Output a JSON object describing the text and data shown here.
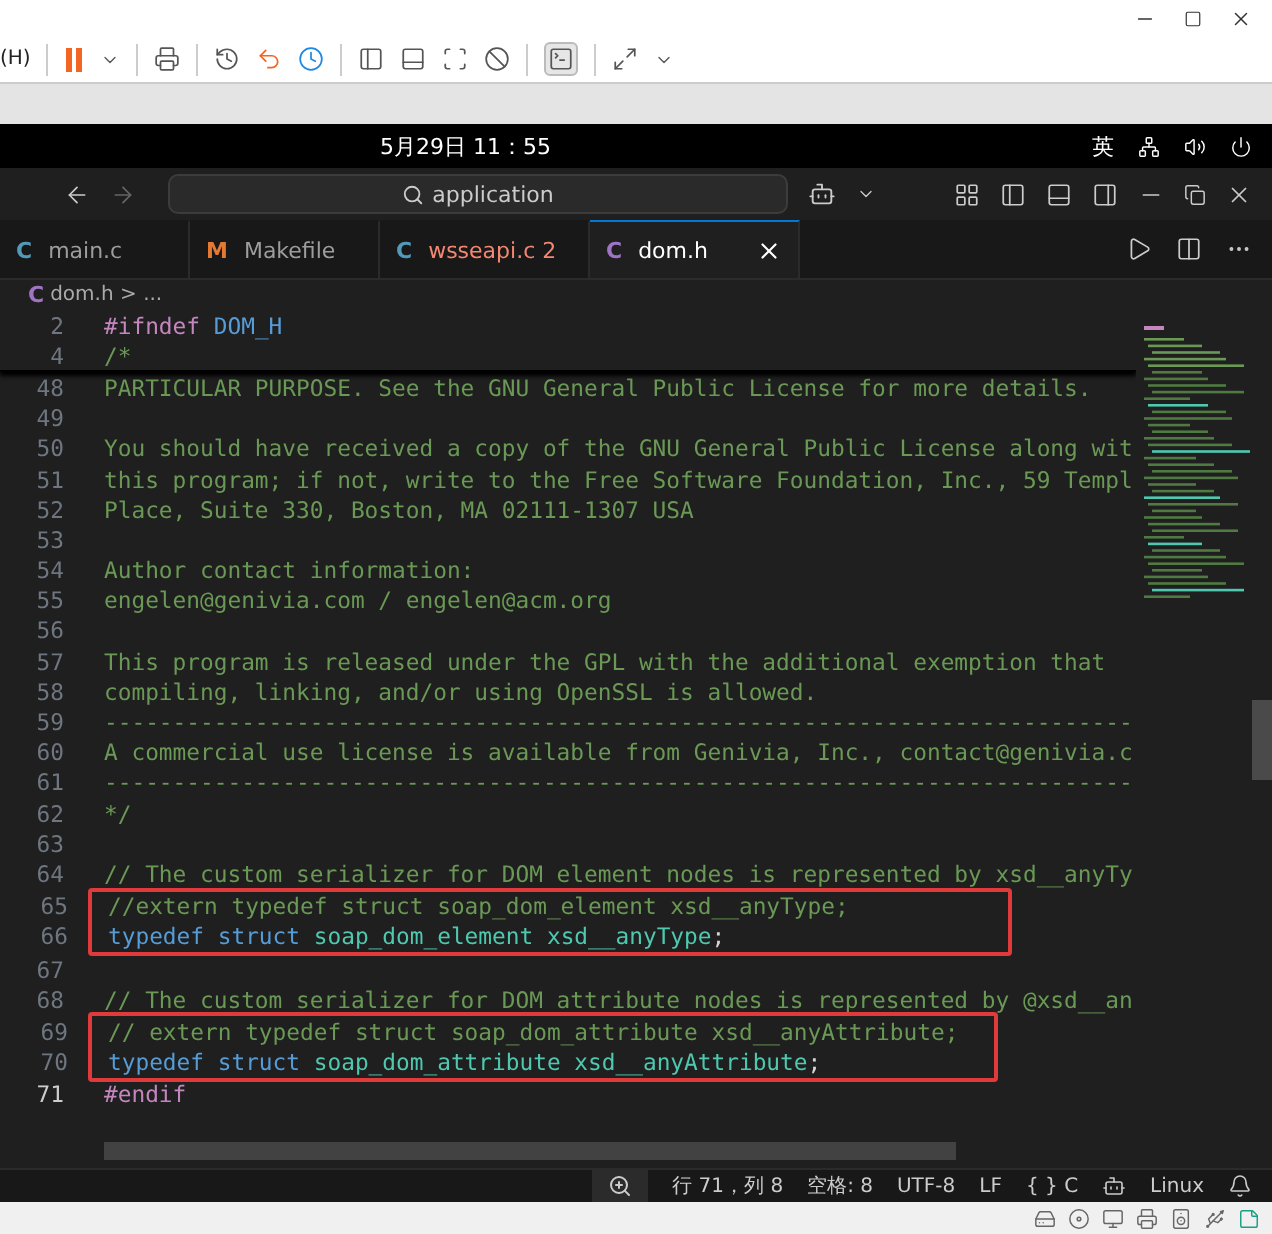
{
  "vm_menu": {
    "label": "(H)"
  },
  "system_bar": {
    "clock": "5月29日 11：55",
    "input_method": "英"
  },
  "title_bar": {
    "search": "application"
  },
  "tabs": [
    {
      "icon_letter": "C",
      "color": "#519aba",
      "label": "main.c",
      "error": false,
      "selected": false
    },
    {
      "icon_letter": "M",
      "color": "#e37933",
      "label": "Makefile",
      "error": false,
      "selected": false
    },
    {
      "icon_letter": "C",
      "color": "#519aba",
      "label": "wsseapi.c",
      "badge": "2",
      "error": true,
      "selected": false
    },
    {
      "icon_letter": "C",
      "color": "#a074c4",
      "label": "dom.h",
      "error": false,
      "selected": true
    }
  ],
  "breadcrumb": {
    "icon_letter": "C",
    "file": "dom.h",
    "separator": ">",
    "rest": "..."
  },
  "sticky_lines": [
    {
      "number": "2",
      "tokens": [
        {
          "kind": "preproc",
          "text": "#ifndef "
        },
        {
          "kind": "macro",
          "text": "DOM_H"
        }
      ]
    },
    {
      "number": "4",
      "tokens": [
        {
          "kind": "comment",
          "text": "/*"
        }
      ]
    }
  ],
  "code_lines": [
    {
      "number": "48",
      "boxed": false,
      "current": false,
      "tokens": [
        {
          "kind": "comment",
          "text": "PARTICULAR PURPOSE. See the GNU General Public License for more details."
        }
      ]
    },
    {
      "number": "49",
      "boxed": false,
      "current": false
    },
    {
      "number": "50",
      "boxed": false,
      "current": false,
      "tokens": [
        {
          "kind": "comment",
          "text": "You should have received a copy of the GNU General Public License along wit"
        }
      ]
    },
    {
      "number": "51",
      "boxed": false,
      "current": false,
      "tokens": [
        {
          "kind": "comment",
          "text": "this program; if not, write to the Free Software Foundation, Inc., 59 Templ"
        }
      ]
    },
    {
      "number": "52",
      "boxed": false,
      "current": false,
      "tokens": [
        {
          "kind": "comment",
          "text": "Place, Suite 330, Boston, MA 02111-1307 USA"
        }
      ]
    },
    {
      "number": "53",
      "boxed": false,
      "current": false
    },
    {
      "number": "54",
      "boxed": false,
      "current": false,
      "tokens": [
        {
          "kind": "comment",
          "text": "Author contact information:"
        }
      ]
    },
    {
      "number": "55",
      "boxed": false,
      "current": false,
      "tokens": [
        {
          "kind": "comment",
          "text": "engelen@genivia.com / engelen@acm.org"
        }
      ]
    },
    {
      "number": "56",
      "boxed": false,
      "current": false
    },
    {
      "number": "57",
      "boxed": false,
      "current": false,
      "tokens": [
        {
          "kind": "comment",
          "text": "This program is released under the GPL with the additional exemption that"
        }
      ]
    },
    {
      "number": "58",
      "boxed": false,
      "current": false,
      "tokens": [
        {
          "kind": "comment",
          "text": "compiling, linking, and/or using OpenSSL is allowed."
        }
      ]
    },
    {
      "number": "59",
      "boxed": false,
      "current": false,
      "tokens": [
        {
          "kind": "comment",
          "text": "---------------------------------------------------------------------------"
        }
      ]
    },
    {
      "number": "60",
      "boxed": false,
      "current": false,
      "tokens": [
        {
          "kind": "comment",
          "text": "A commercial use license is available from Genivia, Inc., contact@genivia.c"
        }
      ]
    },
    {
      "number": "61",
      "boxed": false,
      "current": false,
      "tokens": [
        {
          "kind": "comment",
          "text": "---------------------------------------------------------------------------"
        }
      ]
    },
    {
      "number": "62",
      "boxed": false,
      "current": false,
      "tokens": [
        {
          "kind": "comment",
          "text": "*/"
        }
      ]
    },
    {
      "number": "63",
      "boxed": false,
      "current": false
    },
    {
      "number": "64",
      "boxed": false,
      "current": false,
      "tokens": [
        {
          "kind": "comment",
          "text": "// The custom serializer for DOM element nodes is represented by xsd__anyTy"
        }
      ]
    },
    {
      "number": "65",
      "boxed": true,
      "current": false,
      "tokens": [
        {
          "kind": "comment",
          "text": "//extern typedef struct soap_dom_element xsd__anyType;"
        }
      ]
    },
    {
      "number": "66",
      "boxed": true,
      "current": false,
      "tokens": [
        {
          "kind": "keyword",
          "text": "typedef struct "
        },
        {
          "kind": "type",
          "text": "soap_dom_element xsd__anyType"
        },
        {
          "kind": "plain",
          "text": ";"
        }
      ]
    },
    {
      "number": "67",
      "boxed": false,
      "current": false
    },
    {
      "number": "68",
      "boxed": false,
      "current": false,
      "tokens": [
        {
          "kind": "comment",
          "text": "// The custom serializer for DOM attribute nodes is represented by @xsd__an"
        }
      ]
    },
    {
      "number": "69",
      "boxed": true,
      "current": false,
      "tokens": [
        {
          "kind": "comment",
          "text": "// extern typedef struct soap_dom_attribute xsd__anyAttribute;"
        }
      ]
    },
    {
      "number": "70",
      "boxed": true,
      "current": false,
      "tokens": [
        {
          "kind": "keyword",
          "text": "typedef struct "
        },
        {
          "kind": "type",
          "text": "soap_dom_attribute xsd__anyAttribute"
        },
        {
          "kind": "plain",
          "text": ";"
        }
      ]
    },
    {
      "number": "71",
      "boxed": false,
      "current": true,
      "tokens": [
        {
          "kind": "preproc",
          "text": "#endif"
        }
      ]
    }
  ],
  "status_bar": {
    "position": "行 71，列 8",
    "indent": "空格: 8",
    "encoding": "UTF-8",
    "eol": "LF",
    "language_braces": "{ }",
    "language": "C",
    "platform": "Linux"
  }
}
